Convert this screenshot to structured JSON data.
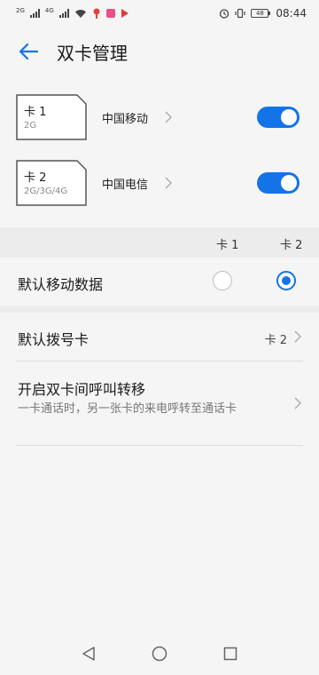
{
  "status_bar": {
    "net1": "2G",
    "net2": "4G",
    "time": "08:44",
    "battery": "48"
  },
  "header": {
    "title": "双卡管理"
  },
  "sims": [
    {
      "name": "卡 1",
      "type": "2G",
      "carrier": "中国移动",
      "enabled": true
    },
    {
      "name": "卡 2",
      "type": "2G/3G/4G",
      "carrier": "中国电信",
      "enabled": true
    }
  ],
  "data_section": {
    "col1": "卡 1",
    "col2": "卡 2",
    "label": "默认移动数据",
    "selected": "卡 2"
  },
  "dial_row": {
    "label": "默认拨号卡",
    "value": "卡 2"
  },
  "forward_row": {
    "title": "开启双卡间呼叫转移",
    "subtitle": "一卡通话时，另一张卡的来电呼转至通话卡"
  },
  "colors": {
    "accent": "#1473e6"
  }
}
